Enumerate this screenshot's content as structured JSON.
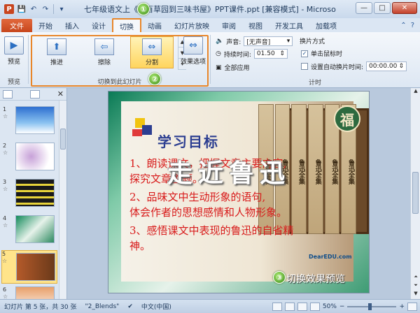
{
  "window": {
    "title": "七年级语文上《从百草园到三味书屋》PPT课件.ppt [兼容模式] - Microsoft PowerPoint",
    "app_icon_letter": "P",
    "qat": {
      "save": "💾",
      "undo": "↶",
      "redo": "↷",
      "more": "▾"
    },
    "controls": {
      "minimize": "—",
      "maximize": "□",
      "close": "✕"
    }
  },
  "tabs": {
    "file": "文件",
    "items": [
      "开始",
      "插入",
      "设计",
      "切换",
      "动画",
      "幻灯片放映",
      "审阅",
      "视图",
      "开发工具",
      "加载项"
    ],
    "active": "切换",
    "help_icons": [
      "⌃",
      "?"
    ]
  },
  "ribbon": {
    "preview": {
      "label": "预览",
      "group_label": "预览"
    },
    "transitions_group_label": "切换到此幻灯片",
    "transitions": [
      {
        "label": "推进",
        "icon": "⬆"
      },
      {
        "label": "擦除",
        "icon": "⇦"
      },
      {
        "label": "分割",
        "icon": "⇔"
      }
    ],
    "selected_transition": "分割",
    "effect_options": "效果选项",
    "timing": {
      "sound_label": "声音:",
      "sound_value": "[无声音]",
      "duration_label": "持续时间:",
      "duration_value": "01.50",
      "apply_all": "全部应用",
      "advance_label": "换片方式",
      "on_click": "单击鼠标时",
      "on_click_checked": true,
      "after_label": "设置自动换片时间:",
      "after_value": "00:00.00",
      "group_label": "计时"
    }
  },
  "badges": [
    "①",
    "②",
    "③"
  ],
  "thumbnails": [
    {
      "num": "1",
      "star": "☆"
    },
    {
      "num": "2",
      "star": "☆"
    },
    {
      "num": "3",
      "star": "☆"
    },
    {
      "num": "4",
      "star": "☆"
    },
    {
      "num": "5",
      "star": "☆",
      "selected": true
    },
    {
      "num": "6",
      "star": "☆"
    }
  ],
  "slide": {
    "heading": "学习目标",
    "lines": [
      "1、朗读课文，把握文章主要内容,",
      "   探究文章主题。",
      "2、品味文中生动形象的语句,",
      "   体会作者的思想感情和人物形象。",
      "3、感悟课文中表现的鲁迅的自省精",
      "   神。"
    ],
    "big_title": "走近鲁迅",
    "book_spine": [
      "鲁迅全集",
      "鲁迅全集",
      "鲁迅全集",
      "鲁迅全集",
      "鲁迅全集",
      "鲁迅全集"
    ],
    "fu": "福",
    "logo": "DearEDU.com",
    "preview_caption": "切换效果预览"
  },
  "status": {
    "slide_info": "幻灯片 第 5 张，共 30 张",
    "theme": "\"2_Blends\"",
    "language": "中文(中国)",
    "zoom": "50%",
    "zoom_minus": "−",
    "zoom_plus": "+"
  }
}
